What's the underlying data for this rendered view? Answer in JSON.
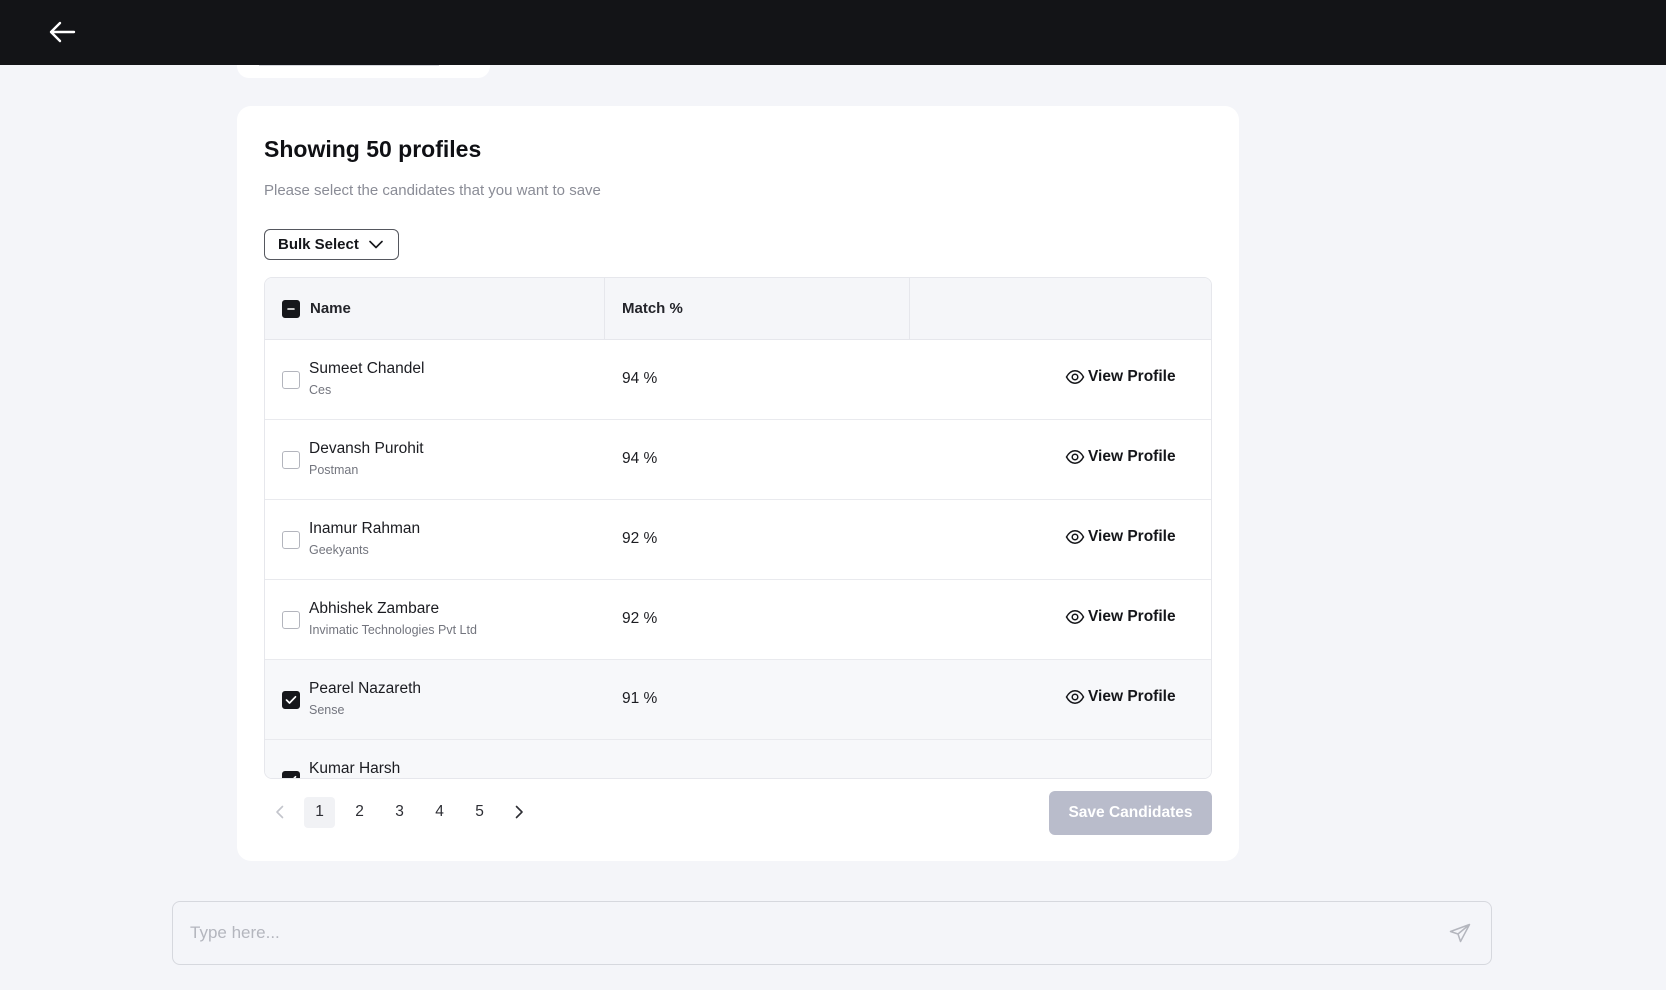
{
  "header": {
    "back_icon": "arrow-left-icon"
  },
  "results": {
    "title": "Showing 50 profiles",
    "subtitle": "Please select the candidates that you want to save",
    "bulk_select_label": "Bulk Select",
    "columns": {
      "name": "Name",
      "match": "Match %",
      "actions": ""
    },
    "candidates": [
      {
        "name": "Sumeet Chandel",
        "company": "Ces",
        "match": "94 %",
        "selected": false,
        "action": "View Profile"
      },
      {
        "name": "Devansh Purohit",
        "company": "Postman",
        "match": "94 %",
        "selected": false,
        "action": "View Profile"
      },
      {
        "name": "Inamur Rahman",
        "company": "Geekyants",
        "match": "92 %",
        "selected": false,
        "action": "View Profile"
      },
      {
        "name": "Abhishek Zambare",
        "company": "Invimatic Technologies Pvt Ltd",
        "match": "92 %",
        "selected": false,
        "action": "View Profile"
      },
      {
        "name": "Pearel Nazareth",
        "company": "Sense",
        "match": "91 %",
        "selected": true,
        "action": "View Profile"
      },
      {
        "name": "Kumar Harsh",
        "company": "",
        "match": "",
        "selected": true,
        "action": ""
      }
    ],
    "pagination": {
      "current_page": "1",
      "pages": [
        "1",
        "2",
        "3",
        "4",
        "5"
      ]
    },
    "save_button_label": "Save Candidates"
  },
  "chat": {
    "placeholder": "Type here...",
    "value": ""
  },
  "colors": {
    "topbar": "#131417",
    "background": "#f4f5f9",
    "save_button_disabled": "#b9bccb",
    "checkbox_checked": "#16171b"
  }
}
